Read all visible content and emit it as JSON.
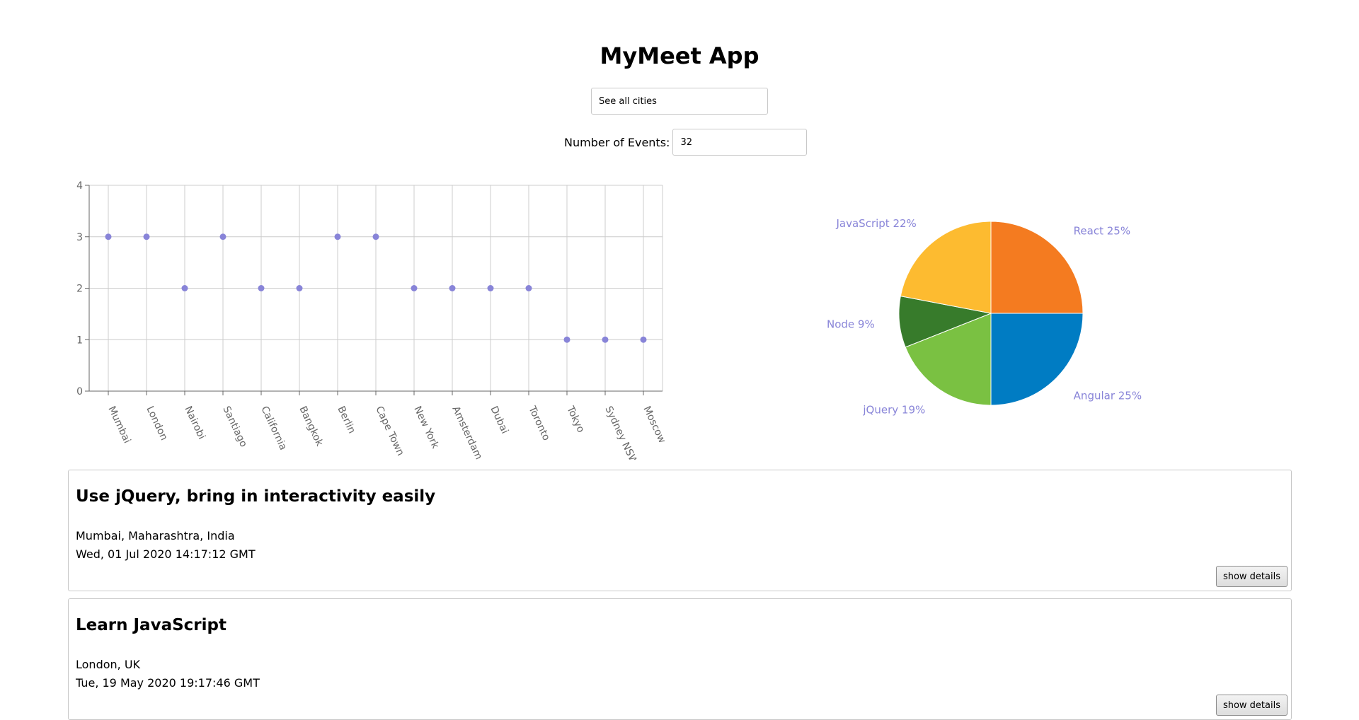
{
  "app": {
    "title": "MyMeet App"
  },
  "search": {
    "placeholder": "See all cities"
  },
  "number_of_events": {
    "label": "Number of Events:",
    "value": "32"
  },
  "chart_data": [
    {
      "type": "scatter",
      "categories": [
        "Mumbai",
        "London",
        "Nairobi",
        "Santiago",
        "California",
        "Bangkok",
        "Berlin",
        "Cape Town",
        "New York",
        "Amsterdam",
        "Dubai",
        "Toronto",
        "Tokyo",
        "Sydney NSW",
        "Moscow"
      ],
      "values": [
        3,
        3,
        2,
        3,
        2,
        2,
        3,
        3,
        2,
        2,
        2,
        2,
        1,
        1,
        1
      ],
      "ylim": [
        0,
        4
      ],
      "yticks": [
        0,
        1,
        2,
        3,
        4
      ],
      "grid": true,
      "point_color": "#8884d8"
    },
    {
      "type": "pie",
      "slices": [
        {
          "label": "React",
          "value": 25,
          "text": "React 25%",
          "color": "#f47b20"
        },
        {
          "label": "Angular",
          "value": 25,
          "text": "Angular 25%",
          "color": "#007cc3"
        },
        {
          "label": "jQuery",
          "value": 19,
          "text": "jQuery 19%",
          "color": "#7ac142"
        },
        {
          "label": "Node",
          "value": 9,
          "text": "Node 9%",
          "color": "#377b2b"
        },
        {
          "label": "JavaScript",
          "value": 22,
          "text": "JavaScript 22%",
          "color": "#fdbb30"
        }
      ]
    }
  ],
  "events": [
    {
      "title": "Use jQuery, bring in interactivity easily",
      "location": "Mumbai, Maharashtra, India",
      "date": "Wed, 01 Jul 2020 14:17:12 GMT",
      "button": "show details"
    },
    {
      "title": "Learn JavaScript",
      "location": "London, UK",
      "date": "Tue, 19 May 2020 19:17:46 GMT",
      "button": "show details"
    }
  ]
}
